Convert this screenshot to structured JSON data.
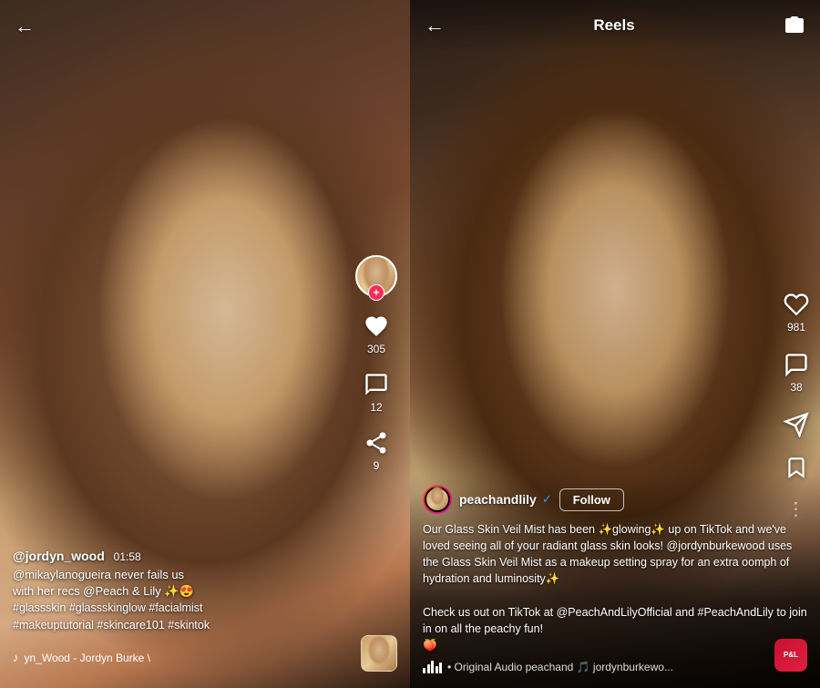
{
  "left": {
    "back_arrow": "←",
    "username": "@jordyn_wood",
    "timestamp": "01:58",
    "caption_line1": "@mikaylanogueira never fails us",
    "caption_line2": "with her recs @Peach & Lily ✨😍",
    "hashtags": "#glassskin #glassskinglow #facialmist\n#makeuptutorial #skincare101 #skintok",
    "music_note": "♪",
    "music_text": "yn_Wood - Jordyn Burke \\",
    "likes_count": "305",
    "comments_count": "12",
    "shares_count": "9",
    "plus_icon": "+"
  },
  "right": {
    "back_arrow": "←",
    "title": "Reels",
    "camera_icon": "📷",
    "username": "peachandlily",
    "follow_label": "Follow",
    "verified": "✓",
    "caption": "Our Glass Skin Veil Mist has been ✨glowing✨ up on TikTok and we've loved seeing all of your radiant glass skin looks! @jordynburkewood uses the Glass Skin Veil Mist as a makeup setting spray for an extra oomph of hydration and luminosity✨\n\nCheck us out on TikTok at @PeachAndLilyOfficial and #PeachAndLily to join in on all the peachy fun!\n🍑",
    "audio_text": "• Original Audio  peachand  🎵 jordynburkewo...",
    "likes_count": "981",
    "comments_count": "38",
    "logo_text": "P&L",
    "three_dots": "⋮"
  }
}
